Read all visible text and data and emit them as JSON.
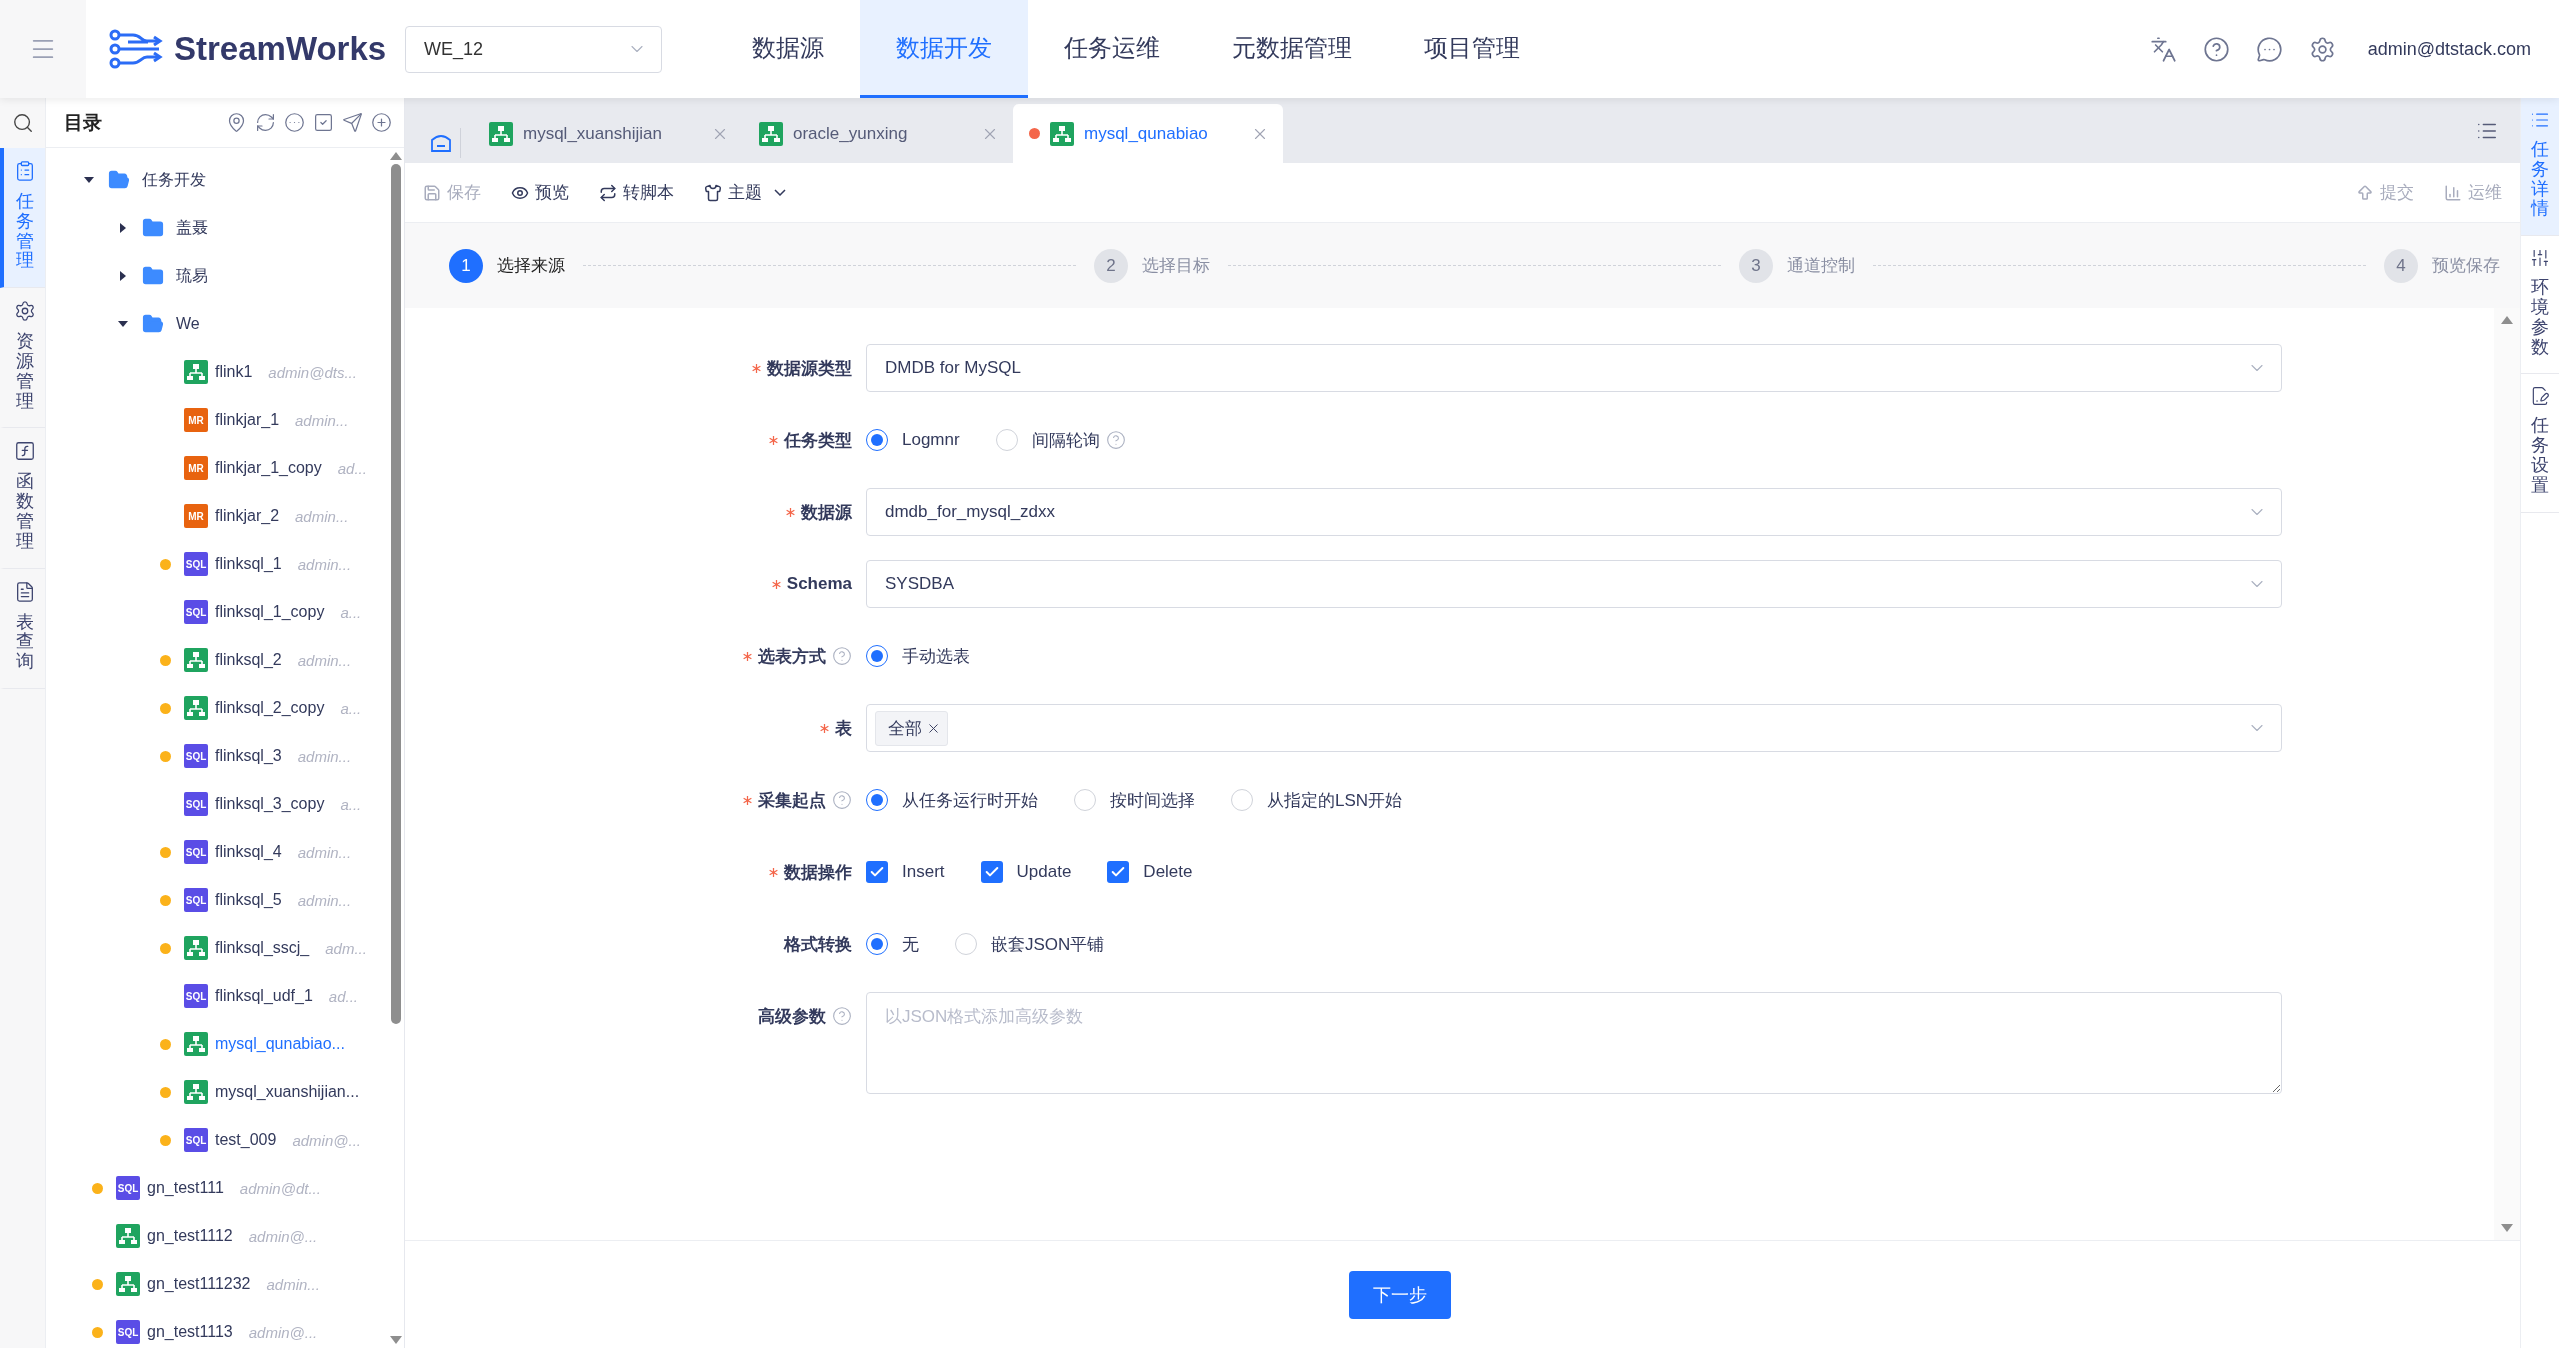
{
  "header": {
    "logo": "StreamWorks",
    "project": "WE_12",
    "nav": [
      {
        "label": "数据源",
        "selected": false
      },
      {
        "label": "数据开发",
        "selected": true
      },
      {
        "label": "任务运维",
        "selected": false
      },
      {
        "label": "元数据管理",
        "selected": false
      },
      {
        "label": "项目管理",
        "selected": false
      }
    ],
    "user": "admin@dtstack.com"
  },
  "left_rail": [
    {
      "kind": "tasks",
      "label": "任务管理",
      "selected": true
    },
    {
      "kind": "resources",
      "label": "资源管理",
      "selected": false
    },
    {
      "kind": "functions",
      "label": "函数管理",
      "selected": false
    },
    {
      "kind": "tables",
      "label": "表查询",
      "selected": false
    }
  ],
  "tree": {
    "title": "目录",
    "items": [
      {
        "kind": "folder",
        "name": "任务开发",
        "expanded": true,
        "children": [
          {
            "kind": "folder",
            "name": "盖聂",
            "expanded": false
          },
          {
            "kind": "folder",
            "name": "琉易",
            "expanded": false
          },
          {
            "kind": "folder",
            "name": "We",
            "expanded": true,
            "children": [
              {
                "kind": "flow",
                "name": "flink1",
                "owner": "admin@dts...",
                "dot": false,
                "selected": false
              },
              {
                "kind": "mr",
                "badge": "MR",
                "name": "flinkjar_1",
                "owner": "admin...",
                "dot": false,
                "selected": false
              },
              {
                "kind": "mr",
                "badge": "MR",
                "name": "flinkjar_1_copy",
                "owner": "ad...",
                "dot": false,
                "selected": false
              },
              {
                "kind": "mr",
                "badge": "MR",
                "name": "flinkjar_2",
                "owner": "admin...",
                "dot": false,
                "selected": false
              },
              {
                "kind": "sql",
                "badge": "SQL",
                "name": "flinksql_1",
                "owner": "admin...",
                "dot": true,
                "selected": false
              },
              {
                "kind": "sql",
                "badge": "SQL",
                "name": "flinksql_1_copy",
                "owner": "a...",
                "dot": false,
                "selected": false
              },
              {
                "kind": "flow",
                "name": "flinksql_2",
                "owner": "admin...",
                "dot": true,
                "selected": false
              },
              {
                "kind": "flow",
                "name": "flinksql_2_copy",
                "owner": "a...",
                "dot": true,
                "selected": false
              },
              {
                "kind": "sql",
                "badge": "SQL",
                "name": "flinksql_3",
                "owner": "admin...",
                "dot": true,
                "selected": false
              },
              {
                "kind": "sql",
                "badge": "SQL",
                "name": "flinksql_3_copy",
                "owner": "a...",
                "dot": false,
                "selected": false
              },
              {
                "kind": "sql",
                "badge": "SQL",
                "name": "flinksql_4",
                "owner": "admin...",
                "dot": true,
                "selected": false
              },
              {
                "kind": "sql",
                "badge": "SQL",
                "name": "flinksql_5",
                "owner": "admin...",
                "dot": true,
                "selected": false
              },
              {
                "kind": "flow",
                "name": "flinksql_sscj_",
                "owner": "adm...",
                "dot": true,
                "selected": false
              },
              {
                "kind": "sql",
                "badge": "SQL",
                "name": "flinksql_udf_1",
                "owner": "ad...",
                "dot": false,
                "selected": false
              },
              {
                "kind": "flow",
                "name": "mysql_qunabiao...",
                "dot": true,
                "selected": true
              },
              {
                "kind": "flow",
                "name": "mysql_xuanshijian...",
                "dot": true,
                "selected": false
              },
              {
                "kind": "sql",
                "badge": "SQL",
                "name": "test_009",
                "owner": "admin@...",
                "dot": true,
                "selected": false
              }
            ]
          }
        ]
      },
      {
        "kind": "sql",
        "badge": "SQL",
        "name": "gn_test111",
        "owner": "admin@dt...",
        "dot": true,
        "selected": false
      },
      {
        "kind": "flow",
        "name": "gn_test1112",
        "owner": "admin@...",
        "dot": false,
        "selected": false
      },
      {
        "kind": "flow",
        "name": "gn_test111232",
        "owner": "admin...",
        "dot": true,
        "selected": false
      },
      {
        "kind": "sql",
        "badge": "SQL",
        "name": "gn_test1113",
        "owner": "admin@...",
        "dot": true,
        "selected": false
      }
    ]
  },
  "tabs": [
    {
      "title": "mysql_xuanshijian",
      "selected": false,
      "dirty": false
    },
    {
      "title": "oracle_yunxing",
      "selected": false,
      "dirty": false
    },
    {
      "title": "mysql_qunabiao",
      "selected": true,
      "dirty": true
    }
  ],
  "toolbar": {
    "left": [
      {
        "kind": "save",
        "label": "保存",
        "disabled": true
      },
      {
        "kind": "preview",
        "label": "预览",
        "disabled": false
      },
      {
        "kind": "convert",
        "label": "转脚本",
        "disabled": false
      },
      {
        "kind": "theme",
        "label": "主题",
        "disabled": false
      }
    ],
    "right": [
      {
        "kind": "submit",
        "label": "提交",
        "disabled": true
      },
      {
        "kind": "ops",
        "label": "运维",
        "disabled": true
      }
    ]
  },
  "steps": [
    {
      "number": "1",
      "label": "选择来源",
      "selected": true
    },
    {
      "number": "2",
      "label": "选择目标",
      "selected": false
    },
    {
      "number": "3",
      "label": "通道控制",
      "selected": false
    },
    {
      "number": "4",
      "label": "预览保存",
      "selected": false
    }
  ],
  "form": {
    "fields": [
      {
        "kind": "select",
        "label": "数据源类型",
        "required": true,
        "help": false,
        "value": "DMDB for MySQL"
      },
      {
        "kind": "radio",
        "label": "任务类型",
        "required": true,
        "help": false,
        "options": [
          {
            "label": "Logmnr",
            "selected": true,
            "help": false
          },
          {
            "label": "间隔轮询",
            "selected": false,
            "help": true
          }
        ]
      },
      {
        "kind": "select",
        "label": "数据源",
        "required": true,
        "help": false,
        "value": "dmdb_for_mysql_zdxx"
      },
      {
        "kind": "select",
        "label": "Schema",
        "required": true,
        "help": false,
        "value": "SYSDBA"
      },
      {
        "kind": "radio",
        "label": "选表方式",
        "required": true,
        "help": true,
        "options": [
          {
            "label": "手动选表",
            "selected": true,
            "help": false
          }
        ]
      },
      {
        "kind": "tags",
        "label": "表",
        "required": true,
        "help": false,
        "tags": [
          "全部"
        ]
      },
      {
        "kind": "radio",
        "label": "采集起点",
        "required": true,
        "help": true,
        "options": [
          {
            "label": "从任务运行时开始",
            "selected": true,
            "help": false
          },
          {
            "label": "按时间选择",
            "selected": false,
            "help": false
          },
          {
            "label": "从指定的LSN开始",
            "selected": false,
            "help": false
          }
        ]
      },
      {
        "kind": "checkbox",
        "label": "数据操作",
        "required": true,
        "help": false,
        "options": [
          {
            "label": "Insert",
            "checked": true
          },
          {
            "label": "Update",
            "checked": true
          },
          {
            "label": "Delete",
            "checked": true
          }
        ]
      },
      {
        "kind": "radio",
        "label": "格式转换",
        "required": false,
        "help": false,
        "options": [
          {
            "label": "无",
            "selected": true,
            "help": false
          },
          {
            "label": "嵌套JSON平铺",
            "selected": false,
            "help": false
          }
        ]
      },
      {
        "kind": "textarea",
        "label": "高级参数",
        "required": false,
        "help": true,
        "placeholder": "以JSON格式添加高级参数"
      }
    ]
  },
  "footer": {
    "next": "下一步"
  },
  "right_rail": [
    {
      "kind": "details",
      "label": "任务详情",
      "selected": true
    },
    {
      "kind": "env",
      "label": "环境参数",
      "selected": false
    },
    {
      "kind": "settings",
      "label": "任务设置",
      "selected": false
    }
  ]
}
